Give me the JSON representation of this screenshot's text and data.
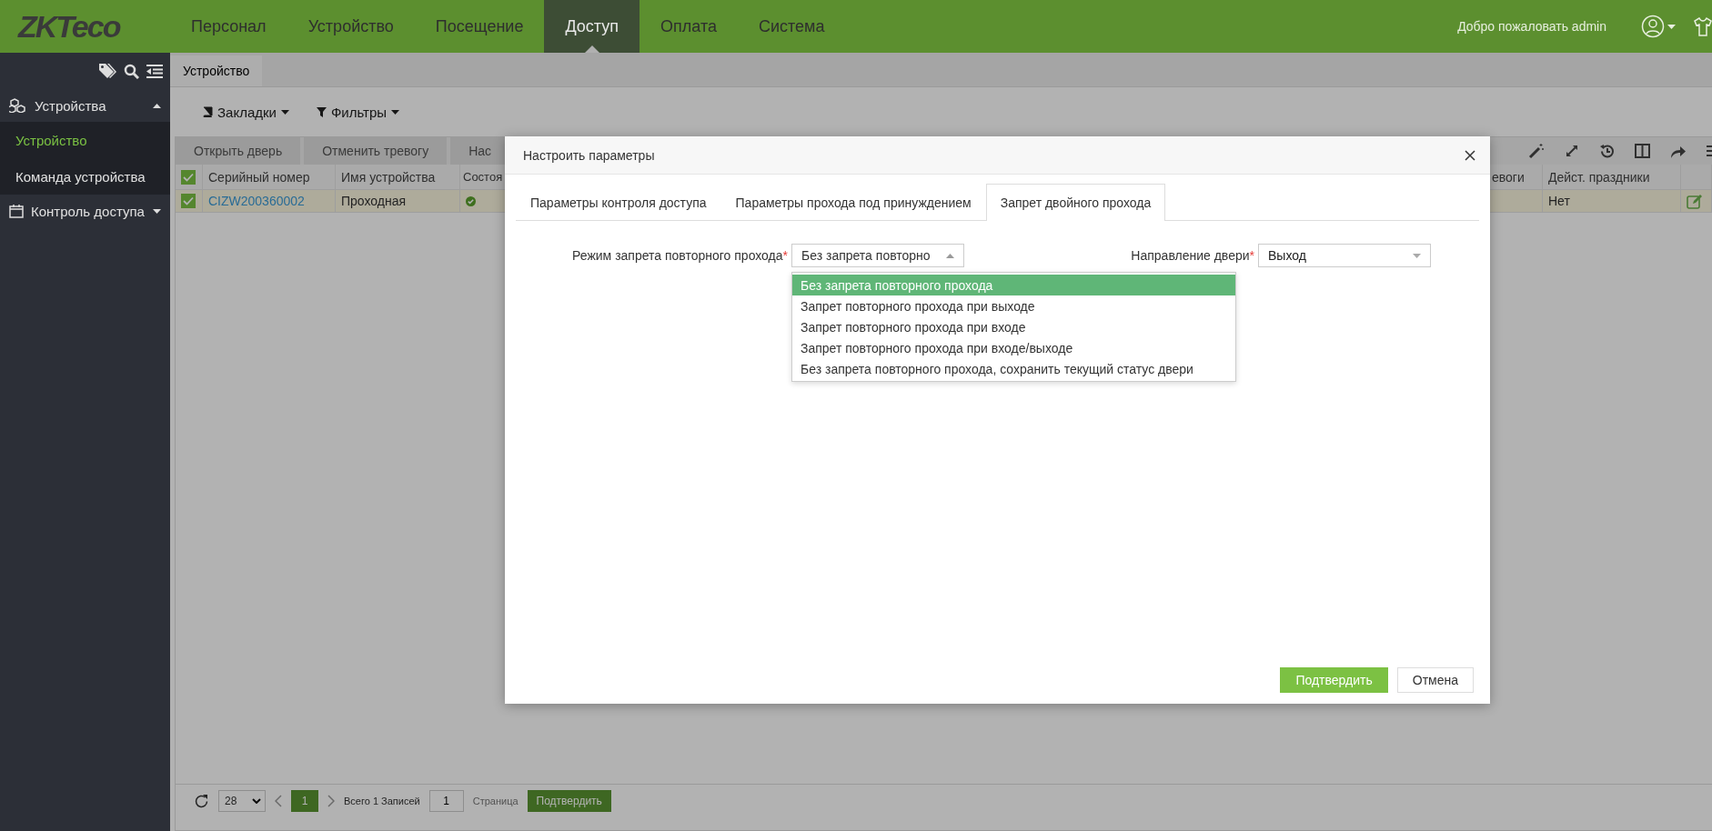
{
  "header": {
    "logo": "ZKTeco",
    "nav": [
      {
        "label": "Персонал",
        "selected": false
      },
      {
        "label": "Устройство",
        "selected": false
      },
      {
        "label": "Посещение",
        "selected": false
      },
      {
        "label": "Доступ",
        "selected": true
      },
      {
        "label": "Оплата",
        "selected": false
      },
      {
        "label": "Система",
        "selected": false
      }
    ],
    "welcome": "Добро пожаловать admin"
  },
  "sidebar": {
    "groups": [
      {
        "label": "Устройства",
        "expanded": true,
        "children": [
          {
            "label": "Устройство",
            "selected": true
          },
          {
            "label": "Команда устройства",
            "selected": false
          }
        ]
      },
      {
        "label": "Контроль доступа",
        "expanded": false
      }
    ]
  },
  "page_tabs": [
    {
      "label": "Устройство",
      "selected": true
    }
  ],
  "toolbar": {
    "bookmarks": "Закладки",
    "filters": "Фильтры"
  },
  "actions": [
    "Открыть дверь",
    "Отменить тревогу",
    "Нас"
  ],
  "table": {
    "all_checked": true,
    "columns": [
      "Серийный номер",
      "Имя устройства",
      "Состоя",
      "евоги",
      "Дейст. праздники"
    ],
    "rows": [
      {
        "checked": true,
        "selected": true,
        "serial": "CIZW200360002",
        "name": "Проходная",
        "holidays": "Нет"
      }
    ]
  },
  "pagination": {
    "page_size": "28",
    "current_page": "1",
    "total": "Всего 1 Записей",
    "page_input": "1",
    "page_label": "Страница",
    "confirm": "Подтвердить"
  },
  "dialog": {
    "title": "Настроить параметры",
    "tabs": [
      {
        "label": "Параметры контроля доступа",
        "selected": false
      },
      {
        "label": "Параметры прохода под принуждением",
        "selected": false
      },
      {
        "label": "Запрет двойного прохода",
        "selected": true
      }
    ],
    "fields": [
      {
        "label": "Режим запрета повторного прохода",
        "mark": "*",
        "value": "Без запрета повторно",
        "open": true,
        "options": [
          {
            "label": "Без запрета повторного прохода",
            "selected": true
          },
          {
            "label": "Запрет повторного прохода при выходе",
            "selected": false
          },
          {
            "label": "Запрет повторного прохода при входе",
            "selected": false
          },
          {
            "label": "Запрет повторного прохода при входе/выходе",
            "selected": false
          },
          {
            "label": "Без запрета повторного прохода, сохранить текущий статус двери",
            "selected": false
          }
        ]
      },
      {
        "label": "Направление двери",
        "mark": "*",
        "value": "Выход",
        "open": false
      }
    ],
    "buttons": [
      {
        "label": "Подтвердить",
        "kind": "primary"
      },
      {
        "label": "Отмена",
        "kind": "secondary"
      }
    ]
  }
}
